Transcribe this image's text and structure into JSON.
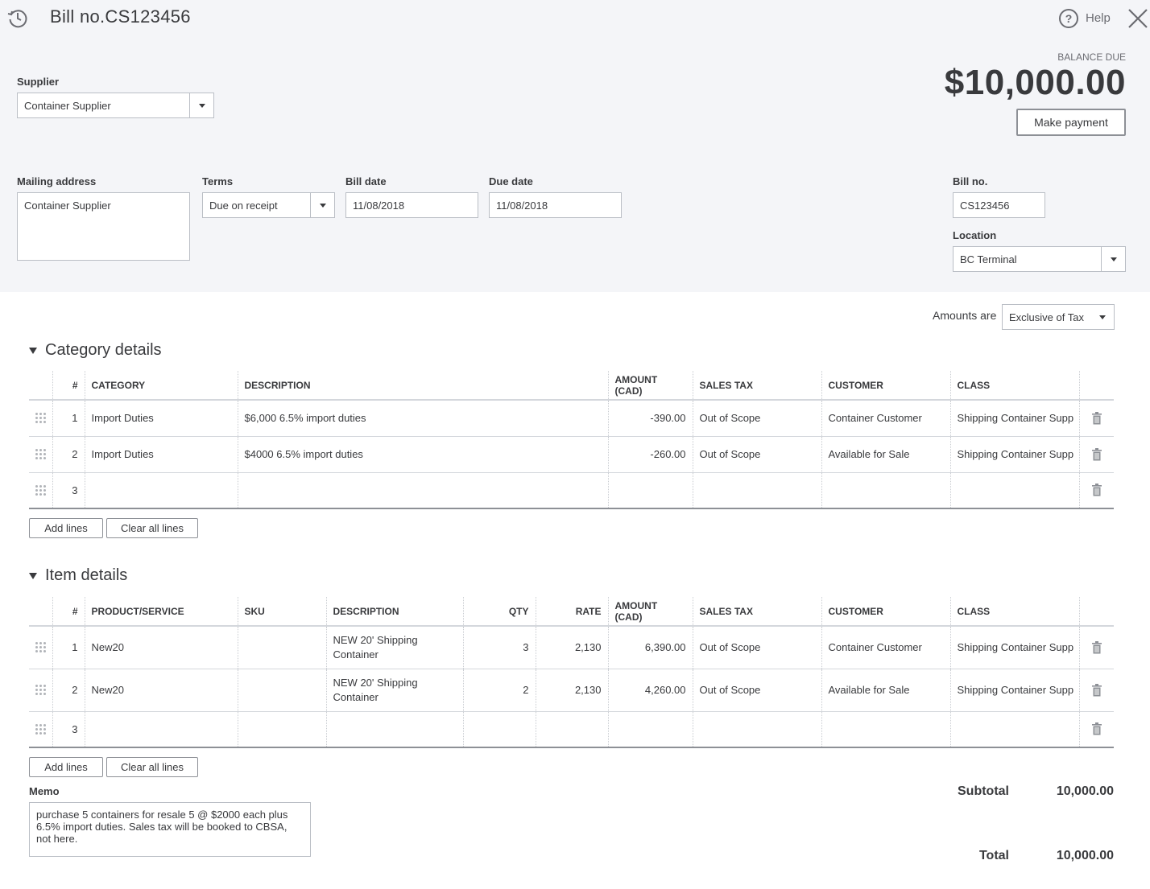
{
  "window": {
    "title": "Bill no.CS123456",
    "help_label": "Help"
  },
  "balance": {
    "label": "BALANCE DUE",
    "amount": "$10,000.00",
    "make_payment_label": "Make payment"
  },
  "supplier": {
    "label": "Supplier",
    "value": "Container Supplier"
  },
  "mailing": {
    "label": "Mailing address",
    "value": "Container Supplier"
  },
  "terms": {
    "label": "Terms",
    "value": "Due on receipt"
  },
  "bill_date": {
    "label": "Bill date",
    "value": "11/08/2018"
  },
  "due_date": {
    "label": "Due date",
    "value": "11/08/2018"
  },
  "bill_no": {
    "label": "Bill no.",
    "value": "CS123456"
  },
  "location": {
    "label": "Location",
    "value": "BC Terminal"
  },
  "amounts_are": {
    "label": "Amounts are",
    "value": "Exclusive of Tax"
  },
  "category": {
    "title": "Category details",
    "headers": [
      "#",
      "CATEGORY",
      "DESCRIPTION",
      "AMOUNT (CAD)",
      "SALES TAX",
      "CUSTOMER",
      "CLASS"
    ],
    "rows": [
      {
        "num": "1",
        "category": "Import Duties",
        "description": "$6,000 6.5% import duties",
        "amount": "-390.00",
        "tax": "Out of Scope",
        "customer": "Container Customer",
        "class": "Shipping Container Supp"
      },
      {
        "num": "2",
        "category": "Import Duties",
        "description": "$4000 6.5% import duties",
        "amount": "-260.00",
        "tax": "Out of Scope",
        "customer": "Available for Sale",
        "class": "Shipping Container Supp"
      },
      {
        "num": "3",
        "category": "",
        "description": "",
        "amount": "",
        "tax": "",
        "customer": "",
        "class": ""
      }
    ],
    "add_lines": "Add lines",
    "clear_lines": "Clear all lines"
  },
  "items": {
    "title": "Item details",
    "headers": [
      "#",
      "PRODUCT/SERVICE",
      "SKU",
      "DESCRIPTION",
      "QTY",
      "RATE",
      "AMOUNT (CAD)",
      "SALES TAX",
      "CUSTOMER",
      "CLASS"
    ],
    "rows": [
      {
        "num": "1",
        "product": "New20",
        "sku": "",
        "description": "NEW 20' Shipping Container",
        "qty": "3",
        "rate": "2,130",
        "amount": "6,390.00",
        "tax": "Out of Scope",
        "customer": "Container Customer",
        "class": "Shipping Container Supp"
      },
      {
        "num": "2",
        "product": "New20",
        "sku": "",
        "description": "NEW 20' Shipping Container",
        "qty": "2",
        "rate": "2,130",
        "amount": "4,260.00",
        "tax": "Out of Scope",
        "customer": "Available for Sale",
        "class": "Shipping Container Supp"
      },
      {
        "num": "3",
        "product": "",
        "sku": "",
        "description": "",
        "qty": "",
        "rate": "",
        "amount": "",
        "tax": "",
        "customer": "",
        "class": ""
      }
    ],
    "add_lines": "Add lines",
    "clear_lines": "Clear all lines"
  },
  "memo": {
    "label": "Memo",
    "value": "purchase 5 containers for resale 5 @ $2000 each plus 6.5% import duties. Sales tax will be booked to CBSA, not here."
  },
  "totals": {
    "subtotal_label": "Subtotal",
    "subtotal": "10,000.00",
    "total_label": "Total",
    "total": "10,000.00"
  },
  "icons": {
    "history": "history-icon",
    "help": "help-icon",
    "close": "close-icon",
    "drag": "drag-handle-icon",
    "trash": "trash-icon",
    "caret": "caret-down-icon"
  }
}
